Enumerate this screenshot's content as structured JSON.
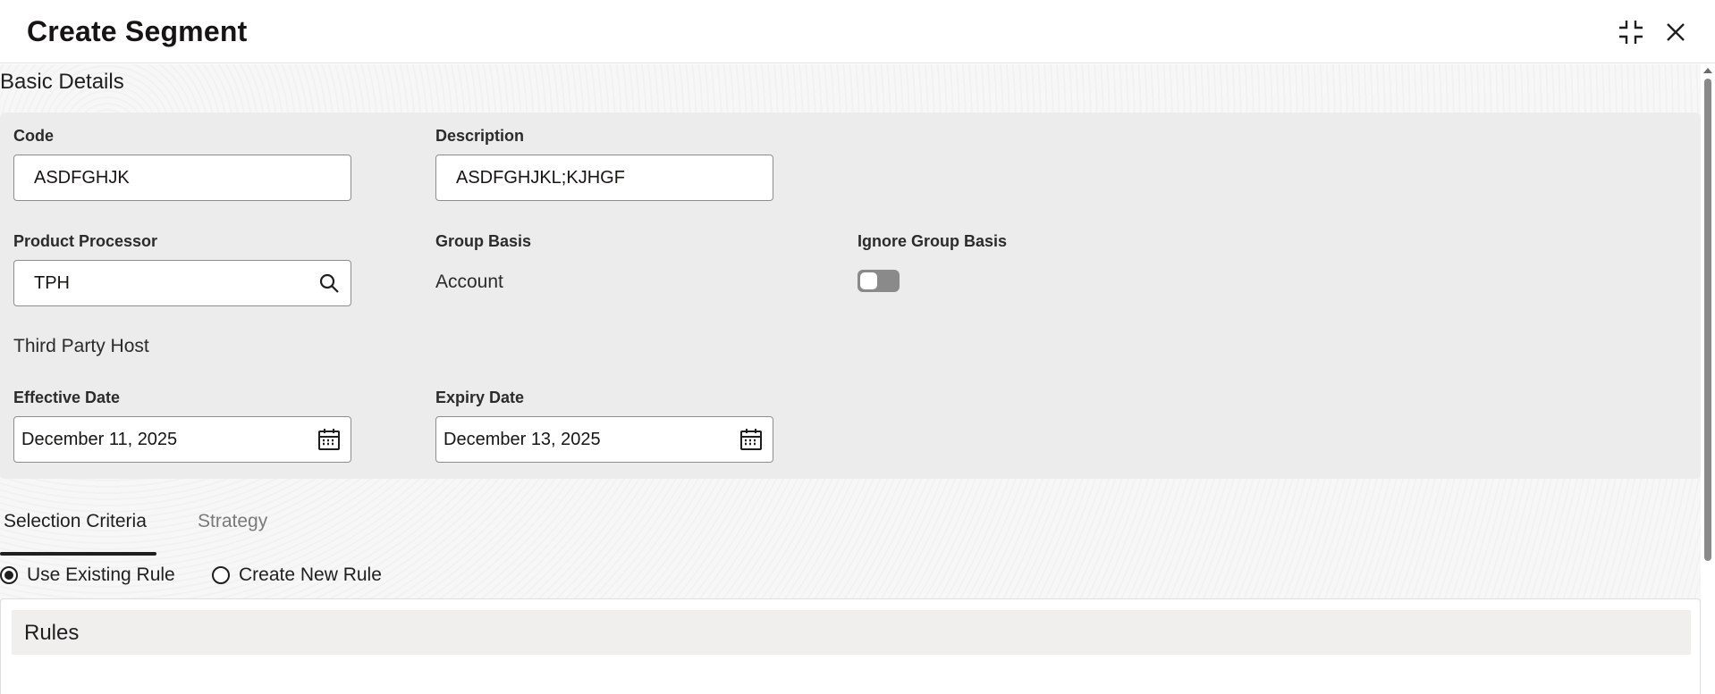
{
  "dialog": {
    "title": "Create Segment",
    "minimize_icon": "collapse-icon",
    "close_icon": "close-icon"
  },
  "basic_details": {
    "heading": "Basic Details",
    "code": {
      "label": "Code",
      "value": "ASDFGHJK"
    },
    "description": {
      "label": "Description",
      "value": "ASDFGHJKL;KJHGF"
    },
    "product_processor": {
      "label": "Product Processor",
      "value": "TPH",
      "icon": "search-icon",
      "helper_text": "Third Party Host"
    },
    "group_basis": {
      "label": "Group Basis",
      "value": "Account"
    },
    "ignore_group_basis": {
      "label": "Ignore Group Basis",
      "checked": false
    },
    "effective_date": {
      "label": "Effective Date",
      "value": "December 11, 2025",
      "icon": "calendar-icon"
    },
    "expiry_date": {
      "label": "Expiry Date",
      "value": "December 13, 2025",
      "icon": "calendar-icon"
    }
  },
  "tabs": [
    {
      "label": "Selection Criteria",
      "active": true
    },
    {
      "label": "Strategy",
      "active": false
    }
  ],
  "rule_options": [
    {
      "label": "Use Existing Rule",
      "selected": true
    },
    {
      "label": "Create New Rule",
      "selected": false
    }
  ],
  "rules": {
    "title": "Rules"
  },
  "colors": {
    "panel_bg": "#ececec",
    "toggle_off": "#8a8a8a",
    "text": "#161513"
  }
}
